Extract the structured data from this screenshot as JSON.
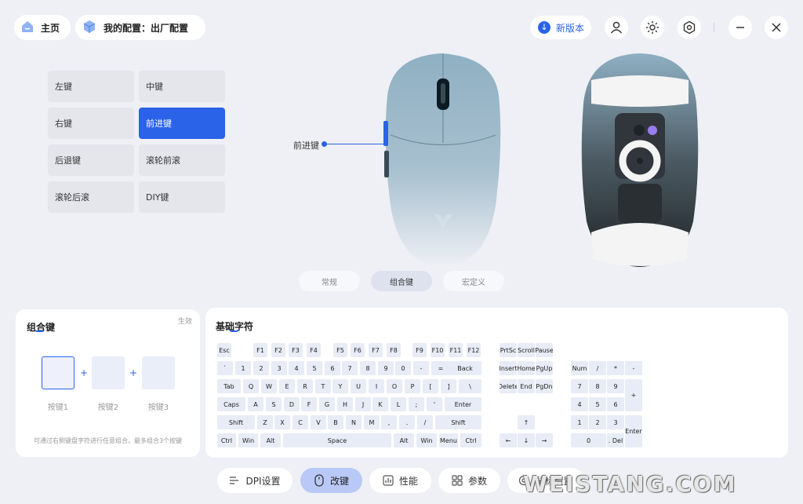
{
  "header": {
    "home_label": "主页",
    "config_label": "我的配置：出厂配置",
    "new_version_label": "新版本"
  },
  "key_list": [
    {
      "label": "左键"
    },
    {
      "label": "中键"
    },
    {
      "label": "右键"
    },
    {
      "label": "前进键"
    },
    {
      "label": "后退键"
    },
    {
      "label": "滚轮前滚"
    },
    {
      "label": "滚轮后滚"
    },
    {
      "label": "DIY键"
    }
  ],
  "selected_key": "前进键",
  "callout_label": "前进键",
  "mode_tabs": [
    {
      "label": "常规"
    },
    {
      "label": "组合键"
    },
    {
      "label": "宏定义"
    }
  ],
  "combo_panel": {
    "title": "组合键",
    "apply_label": "生效",
    "slots": [
      "按键1",
      "按键2",
      "按键3"
    ],
    "plus": "+",
    "hint": "可通过右侧键盘字符进行任意组合，最多组合3个按键"
  },
  "keyboard_panel": {
    "title": "基础字符"
  },
  "keyboard_keys": [
    "Esc",
    "F1",
    "F2",
    "F3",
    "F4",
    "F5",
    "F6",
    "F7",
    "F8",
    "F9",
    "F10",
    "F11",
    "F12",
    "`",
    "1",
    "2",
    "3",
    "4",
    "5",
    "6",
    "7",
    "8",
    "9",
    "0",
    "-",
    "=",
    "Back",
    "Tab",
    "Q",
    "W",
    "E",
    "R",
    "T",
    "Y",
    "U",
    "I",
    "O",
    "P",
    "[",
    "]",
    "\\",
    "Caps",
    "A",
    "S",
    "D",
    "F",
    "G",
    "H",
    "J",
    "K",
    "L",
    ";",
    "'",
    "Enter",
    "Shift",
    "Z",
    "X",
    "C",
    "V",
    "B",
    "N",
    "M",
    ",",
    ".",
    "/",
    "Shift",
    "Ctrl",
    "Win",
    "Alt",
    "Space",
    "Alt",
    "Win",
    "Menu",
    "Ctrl",
    "PrtSc",
    "Scroll",
    "Pause",
    "Insert",
    "Home",
    "PgUp",
    "Delete",
    "End",
    "PgDn",
    "↑",
    "←",
    "↓",
    "→",
    "Num",
    "/",
    "*",
    "-",
    "7",
    "8",
    "9",
    "+",
    "4",
    "5",
    "6",
    "1",
    "2",
    "3",
    "Enter",
    "0",
    ". Del"
  ],
  "bottom_nav": [
    {
      "label": "DPI设置",
      "icon": "dpi-icon"
    },
    {
      "label": "改键",
      "icon": "mouse-icon"
    },
    {
      "label": "性能",
      "icon": "performance-icon"
    },
    {
      "label": "参数",
      "icon": "params-icon"
    },
    {
      "label": "鼠标设置",
      "icon": "settings-icon"
    }
  ],
  "watermark": "WEISTANG.COM",
  "colors": {
    "accent": "#2a63e8",
    "background": "#eef0f5",
    "panel": "#ffffff",
    "key_idle": "#e4e6ec",
    "nav_active": "#b9c9f7"
  }
}
